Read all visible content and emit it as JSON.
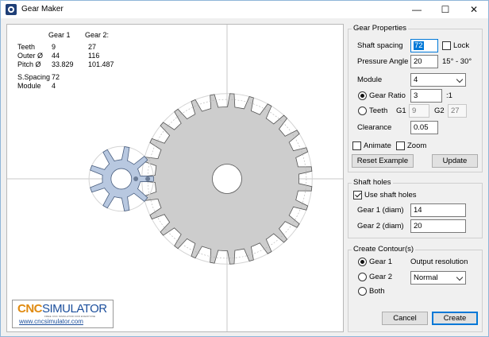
{
  "window": {
    "title": "Gear Maker",
    "minimize": "—",
    "maximize": "☐",
    "close": "✕"
  },
  "info": {
    "header_gear1": "Gear 1",
    "header_gear2": "Gear 2:",
    "rows": [
      {
        "label": "Teeth",
        "g1": "9",
        "g2": "27"
      },
      {
        "label": "Outer Ø",
        "g1": "44",
        "g2": "116"
      },
      {
        "label": "Pitch Ø",
        "g1": "33.829",
        "g2": "101.487"
      }
    ],
    "spacing_label": "S.Spacing",
    "spacing_value": "72",
    "module_label": "Module",
    "module_value": "4"
  },
  "logo": {
    "cnc": "CNC",
    "simulator": "SIMULATOR",
    "tagline": "FREE CNC SIMULATOR FOR EVERYONE",
    "url": "www.cncsimulator.com"
  },
  "gear_properties": {
    "title": "Gear Properties",
    "shaft_spacing_label": "Shaft spacing",
    "shaft_spacing_value": "72",
    "lock_label": "Lock",
    "pressure_angle_label": "Pressure Angle",
    "pressure_angle_value": "20",
    "pressure_angle_range": "15° - 30°",
    "module_label": "Module",
    "module_value": "4",
    "gear_ratio_label": "Gear Ratio",
    "gear_ratio_value": "3",
    "gear_ratio_suffix": ":1",
    "teeth_label": "Teeth",
    "g1_label": "G1",
    "g1_value": "9",
    "g2_label": "G2",
    "g2_value": "27",
    "clearance_label": "Clearance",
    "clearance_value": "0.05",
    "animate_label": "Animate",
    "zoom_label": "Zoom",
    "reset_button": "Reset Example",
    "update_button": "Update"
  },
  "shaft_holes": {
    "title": "Shaft holes",
    "use_label": "Use shaft holes",
    "gear1_label": "Gear 1 (diam)",
    "gear1_value": "14",
    "gear2_label": "Gear 2 (diam)",
    "gear2_value": "20"
  },
  "contours": {
    "title": "Create Contour(s)",
    "options": [
      "Gear 1",
      "Gear 2",
      "Both"
    ],
    "resolution_label": "Output resolution",
    "resolution_value": "Normal",
    "cancel_button": "Cancel",
    "create_button": "Create"
  },
  "colors": {
    "gear1_fill": "#b8c8e0",
    "gear2_fill": "#cdcdcd",
    "accent": "#0078d7"
  }
}
